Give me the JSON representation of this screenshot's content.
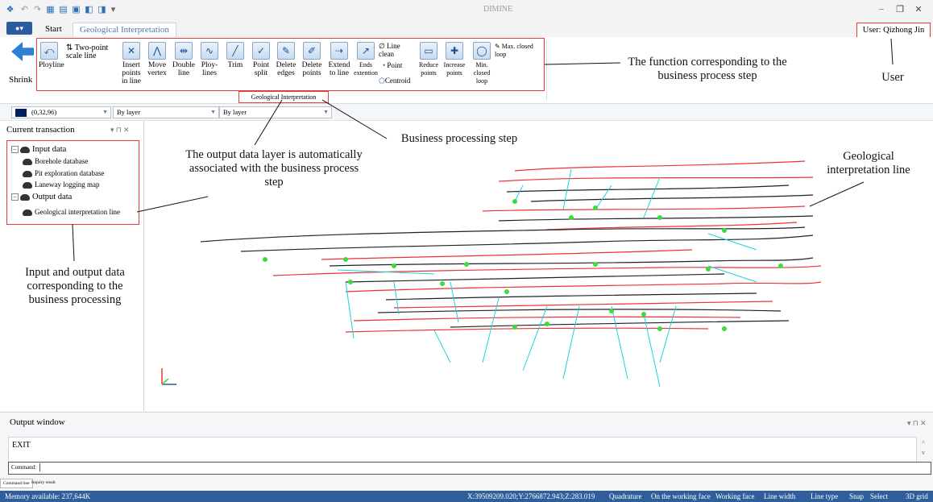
{
  "app": {
    "title": "DIMINE",
    "user": "User: Qizhong Jin"
  },
  "tabs": {
    "app_menu": "●▾",
    "start": "Start",
    "geo": "Geological Interpretation"
  },
  "ribbon": {
    "shrink": "Shrink",
    "polyline": "Ployline",
    "two_point": "Two-point scale line",
    "insert_points": "Insert points in line",
    "move_vertex": "Move vertex",
    "double_line": "Double line",
    "ploy_lines": "Ploy-lines",
    "trim": "Trim",
    "point_split": "Point split",
    "delete_edges": "Delete edges",
    "delete_points": "Delete points",
    "extend_to_line": "Extend to line",
    "ends_extention": "Ends extention",
    "line_clean": "Line clean",
    "point": "Point",
    "centroid": "Centroid",
    "reduce_points": "Reduce points",
    "increase_points": "Increase points",
    "min_closed_loop": "Min. closed loop",
    "max_closed_loop": "Max. closed loop",
    "group_label": "Geological Interpretation"
  },
  "toolbar": {
    "color_value": "(0,32,96)",
    "color_hex": "#002060",
    "layer1": "By layer",
    "layer2": "By layer"
  },
  "panel": {
    "title": "Current transaction",
    "input_data": "Input data",
    "inputs": [
      "Borehole database",
      "Pit exploration database",
      "Laneway logging map"
    ],
    "output_data": "Output data",
    "outputs": [
      "Geological interpretation line"
    ]
  },
  "annotations": {
    "function": "The function corresponding to the business process step",
    "user": "User",
    "business_step": "Business processing step",
    "output_layer": "The output data layer is automatically associated with the business process step",
    "geo_line": "Geological interpretation line",
    "io_data": "Input and output data corresponding to the business processing"
  },
  "output_window": {
    "title": "Output window",
    "log": "EXIT",
    "command_label": "Command:",
    "tabs": [
      "Command line",
      "Inquiry result"
    ]
  },
  "status": {
    "memory": "Memory available: 237,644K",
    "coords": "X:39509209.020;Y:2766872.943;Z:283.019",
    "items": [
      "Quadrature",
      "On the working face",
      "Working face",
      "Line width",
      "Line type",
      "Snap",
      "Select",
      "3D grid"
    ]
  },
  "colors": {
    "accent": "#2e5e9c",
    "highlight": "#e53b3b",
    "red_line": "#e33",
    "black_line": "#222",
    "cyan_line": "#19d4e0",
    "green_point": "#3ddc3d"
  }
}
